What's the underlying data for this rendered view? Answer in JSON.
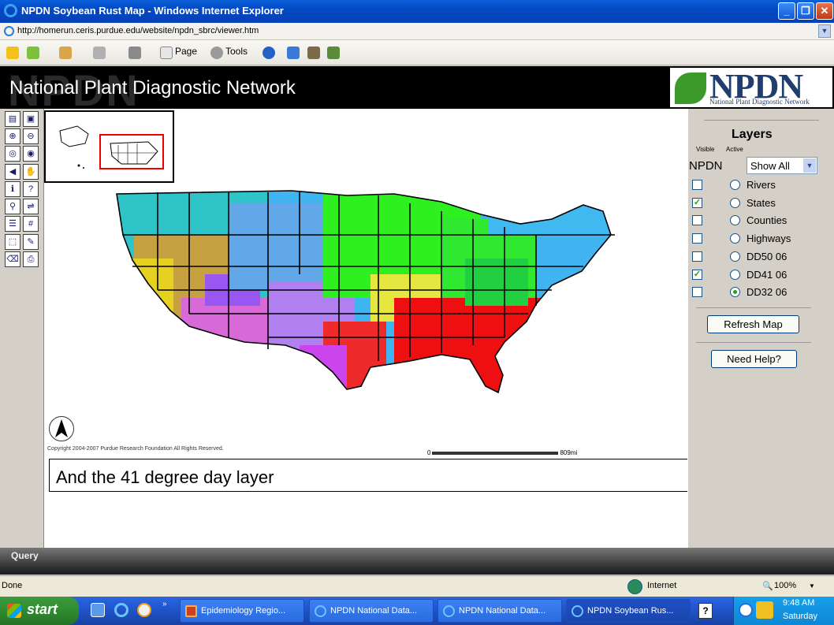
{
  "window": {
    "title": "NPDN Soybean Rust Map - Windows Internet Explorer",
    "min_label": "_",
    "max_label": "❐",
    "close_label": "✕"
  },
  "address": {
    "url": "http://homerun.ceris.purdue.edu/website/npdn_sbrc/viewer.htm"
  },
  "toolbar": {
    "page_label": "Page",
    "tools_label": "Tools"
  },
  "banner": {
    "title": "National Plant Diagnostic Network",
    "ghost": "NPDN",
    "logo_big": "NPDN",
    "logo_small": "National Plant Diagnostic Network"
  },
  "map": {
    "copyright": "Copyright 2004-2007  Purdue Research Foundation All Rights Reserved.",
    "scale_start": "0",
    "scale_end": "809mi",
    "caption": "And the 41 degree day layer"
  },
  "layers": {
    "title": "Layers",
    "visible_label": "Visible",
    "active_label": "Active",
    "service_label": "NPDN",
    "show_select": "Show All",
    "items": [
      {
        "label": "Rivers",
        "visible": false,
        "active": false
      },
      {
        "label": "States",
        "visible": true,
        "active": false
      },
      {
        "label": "Counties",
        "visible": false,
        "active": false
      },
      {
        "label": "Highways",
        "visible": false,
        "active": false
      },
      {
        "label": "DD50 06",
        "visible": false,
        "active": false
      },
      {
        "label": "DD41 06",
        "visible": true,
        "active": false
      },
      {
        "label": "DD32 06",
        "visible": false,
        "active": true
      }
    ],
    "refresh_label": "Refresh Map",
    "help_label": "Need Help?"
  },
  "query": {
    "label": "Query"
  },
  "status": {
    "text": "Done",
    "zone": "Internet",
    "zoom": "100%"
  },
  "taskbar": {
    "start_label": "start",
    "tasks": [
      {
        "label": "Epidemiology Regio..."
      },
      {
        "label": "NPDN National Data..."
      },
      {
        "label": "NPDN National Data..."
      },
      {
        "label": "NPDN Soybean Rus..."
      }
    ],
    "time": "9:48 AM",
    "day": "Saturday"
  },
  "colors": {
    "titlebar": "#0449c4",
    "taskbar": "#245edb",
    "start": "#2f8b2f",
    "logo_text": "#1f3e6e"
  }
}
